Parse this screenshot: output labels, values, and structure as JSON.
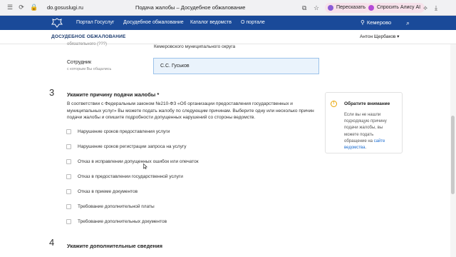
{
  "browser": {
    "url": "do.gosuslugi.ru",
    "page_title": "Подача жалобы – Досудебное обжалование",
    "translate_label": "Пересказать",
    "alice_label": "Спросить Алису AI"
  },
  "portal": {
    "nav": [
      "Портал Госуслуг",
      "Досудебное обжалование",
      "Каталог ведомств",
      "О портале"
    ],
    "location": "Кемерово",
    "section_title": "ДОСУДЕБНОЕ ОБЖАЛОВАНИЕ",
    "user": "Антон Щербаков ▾"
  },
  "form": {
    "cut_label": "обязательного (???)",
    "cut_value": "Кемеровского муниципального округа",
    "employee_label": "Сотрудник",
    "employee_sublabel": "с которым Вы общались",
    "employee_value": "С.С. Гуськов",
    "step3_num": "3",
    "step3_title": "Укажите причину подачи жалобы *",
    "step3_desc": "В соответствии с Федеральным законом №210-ФЗ «Об организации предоставления государственных и муниципальных услуг» Вы можете подать жалобу по следующим причинам. Выберите одну или несколько причин подачи жалобы и опишите подробности допущенных нарушений со стороны ведомств.",
    "reasons": [
      "Нарушение сроков предоставления услуги",
      "Нарушение сроков регистрации запроса на услугу",
      "Отказ в исправлении допущенных ошибок или опечаток",
      "Отказ в предоставлении государственной услуги",
      "Отказ в приеме документов",
      "Требование дополнительной платы",
      "Требование дополнительных документов"
    ],
    "step4_num": "4",
    "step4_title": "Укажите дополнительные сведения"
  },
  "attention": {
    "title": "Обратите внимание",
    "text": "Если вы не нашли подходящую причину подачи жалобы, вы можете подать обращение на ",
    "link": "сайте ведомства",
    "end": "."
  },
  "colors": {
    "header_blue": "#1a4a99",
    "input_bg": "#eaf3fc",
    "warning": "#e8a300",
    "link": "#1a6cd0"
  }
}
